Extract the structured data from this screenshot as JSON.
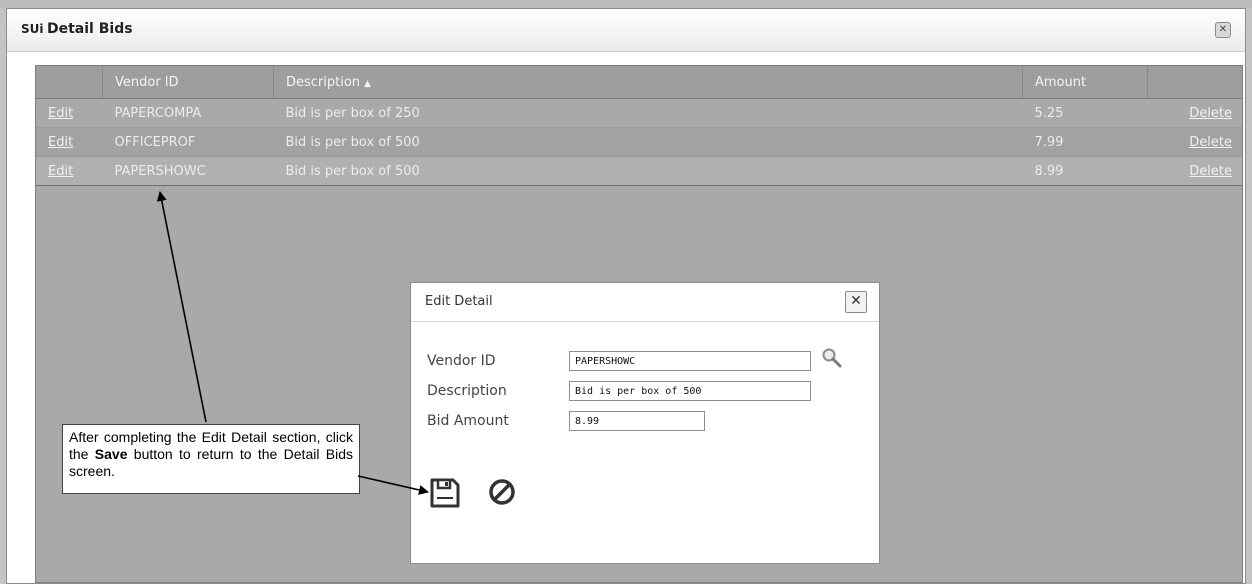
{
  "window": {
    "logo": "SUi",
    "title": "Detail Bids"
  },
  "grid": {
    "columns": {
      "vendor_id": "Vendor ID",
      "description": "Description",
      "amount": "Amount"
    },
    "sort_indicator": "▲",
    "rows": [
      {
        "edit": "Edit",
        "vendor_id": "PAPERCOMPA",
        "description": "Bid is per box of 250",
        "amount": "5.25",
        "delete": "Delete"
      },
      {
        "edit": "Edit",
        "vendor_id": "OFFICEPROF",
        "description": "Bid is per box of 500",
        "amount": "7.99",
        "delete": "Delete"
      },
      {
        "edit": "Edit",
        "vendor_id": "PAPERSHOWC",
        "description": "Bid is per box of 500",
        "amount": "8.99",
        "delete": "Delete"
      }
    ]
  },
  "dialog": {
    "title": "Edit Detail",
    "close_symbol": "✕",
    "fields": {
      "vendor_id_label": "Vendor ID",
      "vendor_id_value": "PAPERSHOWC",
      "description_label": "Description",
      "description_value": "Bid is per box of 500",
      "bid_amount_label": "Bid Amount",
      "bid_amount_value": "8.99"
    },
    "icons": {
      "lookup": "magnifier-icon",
      "save": "save-icon",
      "cancel": "cancel-icon"
    }
  },
  "callout": {
    "text_before": "After completing the Edit Detail section, click the ",
    "text_bold": "Save",
    "text_after": " button to return to the Detail Bids screen."
  }
}
